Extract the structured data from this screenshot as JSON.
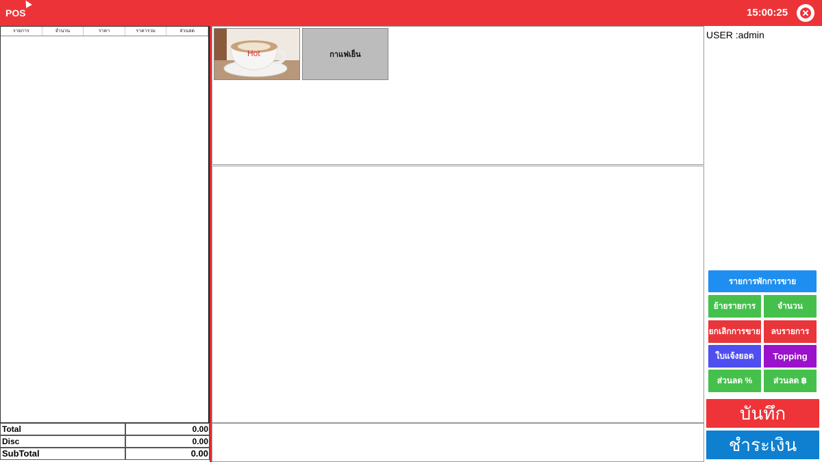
{
  "app": {
    "title": "POS",
    "clock": "15:00:25"
  },
  "order_table": {
    "columns": [
      "รายการ",
      "จำนวน",
      "ราคา",
      "ราคารวม",
      "ส่วนลด"
    ]
  },
  "totals": [
    {
      "label": "Total",
      "value": "0.00"
    },
    {
      "label": "Disc",
      "value": "0.00"
    },
    {
      "label": "SubTotal",
      "value": "0.00"
    }
  ],
  "products": [
    {
      "name": "Hot",
      "icon": "coffee-cup-image"
    },
    {
      "name": "กาแฟเย็น"
    }
  ],
  "user": {
    "label": "USER :admin"
  },
  "buttons": {
    "held_sales": "รายการพักการขาย",
    "move_item": "ย้ายรายการ",
    "quantity": "จำนวน",
    "cancel_sale": "ยกเลิกการขาย",
    "delete_item": "ลบรายการ",
    "invoice": "ใบแจ้งยอด",
    "topping": "Topping",
    "discount_percent": "ส่วนลด %",
    "discount_baht": "ส่วนลด ฿",
    "save": "บันทึก",
    "pay": "ชำระเงิน"
  },
  "colors": {
    "titlebar": "#ec3438",
    "blue": "#1e8ff0",
    "green": "#46c04c",
    "red": "#e8363b",
    "indigo": "#4f4ff0",
    "purple": "#9a12c9",
    "pay": "#0f7fd0"
  }
}
